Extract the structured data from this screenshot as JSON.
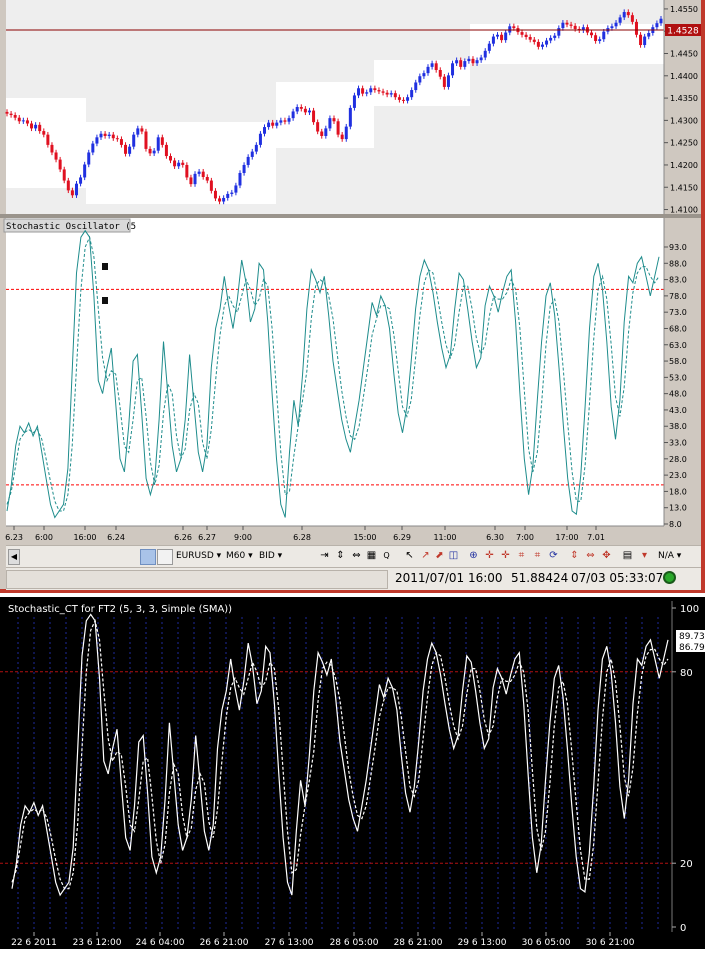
{
  "colors": {
    "price_bg": "#eeeeee",
    "osc_line": "#1e8c8c",
    "level_line": "#ff0000",
    "up_candle": "#2030e0",
    "down_candle": "#e01020",
    "bottom_bg": "#000000",
    "bottom_line": "#ffffff",
    "bottom_level": "#b01010",
    "bottom_grid": "#1e2a9a"
  },
  "price_chart": {
    "price_tag": "1.4528",
    "y_ticks": [
      "1.4550",
      "1.4500",
      "1.4450",
      "1.4400",
      "1.4350",
      "1.4300",
      "1.4250",
      "1.4200",
      "1.4150",
      "1.4100"
    ]
  },
  "oscillator_panel": {
    "title": "Stochastic Oscillator (5",
    "y_ticks": [
      "93.0",
      "88.0",
      "83.0",
      "78.0",
      "73.0",
      "68.0",
      "63.0",
      "58.0",
      "53.0",
      "48.0",
      "43.0",
      "38.0",
      "33.0",
      "28.0",
      "23.0",
      "18.0",
      "13.0",
      "8.0"
    ],
    "x_ticks": [
      "6.23",
      "6:00",
      "16:00",
      "6.24",
      "6.26",
      "6.27",
      "9:00",
      "6.28",
      "15:00",
      "6.29",
      "11:00",
      "6.30",
      "7:00",
      "17:00",
      "7.01"
    ]
  },
  "toolbar": {
    "symbol": "EURUSD",
    "timeframe": "M60",
    "side": "BID",
    "na_label": "N/A"
  },
  "status_bar": {
    "datetime": "2011/07/01 16:00",
    "value": "51.88424",
    "clock": "07/03 05:33:07"
  },
  "bottom_chart": {
    "title": "Stochastic_CT for FT2 (5, 3, 3, Simple (SMA))",
    "y_ticks": [
      "100",
      "80",
      "20",
      "0"
    ],
    "value_tags": [
      "89.73",
      "86.79"
    ],
    "x_ticks": [
      "22 6 2011",
      "23 6 12:00",
      "24 6 04:00",
      "26 6 21:00",
      "27 6 13:00",
      "28 6 05:00",
      "28 6 21:00",
      "29 6 13:00",
      "30 6 05:00",
      "30 6 21:00"
    ]
  },
  "chart_data": [
    {
      "type": "candlestick",
      "title": "",
      "y_range": [
        1.409,
        1.457
      ],
      "close_series": [
        1.4315,
        1.4312,
        1.4306,
        1.4298,
        1.43,
        1.4293,
        1.4282,
        1.429,
        1.4276,
        1.4268,
        1.4245,
        1.4228,
        1.4212,
        1.419,
        1.4165,
        1.4143,
        1.4132,
        1.4158,
        1.4172,
        1.4201,
        1.4228,
        1.4248,
        1.4262,
        1.427,
        1.4265,
        1.4268,
        1.426,
        1.4258,
        1.4245,
        1.4225,
        1.4241,
        1.4268,
        1.4282,
        1.4275,
        1.4236,
        1.4226,
        1.4232,
        1.4262,
        1.4245,
        1.422,
        1.421,
        1.4197,
        1.4205,
        1.42,
        1.4172,
        1.4157,
        1.418,
        1.4185,
        1.4173,
        1.4165,
        1.4142,
        1.4125,
        1.4118,
        1.4126,
        1.4135,
        1.4138,
        1.4154,
        1.4182,
        1.42,
        1.4218,
        1.423,
        1.4245,
        1.427,
        1.4285,
        1.4295,
        1.4288,
        1.4295,
        1.43,
        1.4297,
        1.4305,
        1.432,
        1.433,
        1.4326,
        1.4318,
        1.4322,
        1.4296,
        1.4275,
        1.4265,
        1.4282,
        1.4305,
        1.4298,
        1.4268,
        1.4258,
        1.4286,
        1.4328,
        1.4356,
        1.4372,
        1.436,
        1.4363,
        1.4372,
        1.4368,
        1.4365,
        1.4362,
        1.4358,
        1.4361,
        1.4352,
        1.4346,
        1.4344,
        1.4352,
        1.4368,
        1.4385,
        1.4399,
        1.4406,
        1.442,
        1.4428,
        1.4413,
        1.4398,
        1.4375,
        1.4401,
        1.4428,
        1.4435,
        1.442,
        1.4433,
        1.4438,
        1.4428,
        1.4435,
        1.4441,
        1.4456,
        1.4472,
        1.4488,
        1.4492,
        1.448,
        1.4497,
        1.4511,
        1.4507,
        1.4498,
        1.4492,
        1.4487,
        1.4481,
        1.4476,
        1.4465,
        1.447,
        1.4479,
        1.4485,
        1.449,
        1.4507,
        1.4519,
        1.4515,
        1.4512,
        1.4505,
        1.4502,
        1.4509,
        1.4497,
        1.4491,
        1.4478,
        1.4482,
        1.4499,
        1.4507,
        1.4511,
        1.4519,
        1.4531,
        1.4543,
        1.4536,
        1.4521,
        1.4492,
        1.4469,
        1.4488,
        1.4496,
        1.4509,
        1.4518,
        1.4528
      ]
    },
    {
      "type": "line",
      "title": "Stochastic Oscillator (5",
      "ylim": [
        8,
        93
      ],
      "levels": [
        80,
        20
      ],
      "series": [
        {
          "values": [
            12,
            20,
            32,
            38,
            36,
            39,
            35,
            38,
            30,
            22,
            14,
            10,
            12,
            14,
            25,
            55,
            85,
            96,
            98,
            96,
            78,
            52,
            48,
            56,
            62,
            45,
            28,
            24,
            38,
            58,
            60,
            42,
            22,
            17,
            22,
            40,
            64,
            48,
            32,
            24,
            28,
            40,
            60,
            45,
            30,
            24,
            32,
            56,
            68,
            74,
            84,
            75,
            68,
            77,
            89,
            82,
            70,
            74,
            88,
            86,
            70,
            48,
            28,
            14,
            10,
            30,
            46,
            38,
            54,
            74,
            86,
            83,
            79,
            84,
            72,
            58,
            49,
            40,
            34,
            30,
            38,
            46,
            56,
            66,
            76,
            72,
            78,
            75,
            68,
            54,
            42,
            36,
            44,
            58,
            74,
            84,
            89,
            86,
            79,
            70,
            62,
            56,
            60,
            74,
            85,
            83,
            74,
            64,
            56,
            59,
            75,
            81,
            78,
            73,
            79,
            84,
            86,
            70,
            48,
            28,
            17,
            26,
            46,
            64,
            78,
            82,
            72,
            56,
            38,
            22,
            12,
            11,
            23,
            44,
            68,
            84,
            88,
            80,
            64,
            44,
            34,
            46,
            70,
            84,
            82,
            88,
            90,
            84,
            78,
            84,
            90
          ]
        },
        {
          "values": [
            14,
            18,
            26,
            34,
            36,
            37,
            36,
            37,
            34,
            28,
            21,
            15,
            12,
            12,
            17,
            32,
            56,
            80,
            93,
            96,
            90,
            74,
            59,
            52,
            55,
            54,
            44,
            32,
            30,
            40,
            52,
            53,
            41,
            27,
            20,
            26,
            42,
            51,
            48,
            35,
            28,
            31,
            43,
            48,
            45,
            33,
            28,
            37,
            52,
            66,
            75,
            78,
            75,
            73,
            78,
            83,
            80,
            75,
            77,
            83,
            81,
            68,
            49,
            30,
            17,
            18,
            29,
            38,
            46,
            55,
            71,
            81,
            83,
            82,
            78,
            71,
            60,
            49,
            41,
            35,
            34,
            38,
            47,
            56,
            66,
            71,
            75,
            75,
            74,
            66,
            55,
            44,
            41,
            46,
            59,
            72,
            82,
            86,
            85,
            78,
            70,
            63,
            59,
            63,
            73,
            81,
            81,
            74,
            65,
            60,
            63,
            72,
            78,
            77,
            77,
            79,
            83,
            80,
            68,
            49,
            31,
            24,
            30,
            45,
            63,
            75,
            77,
            70,
            55,
            39,
            24,
            15,
            15,
            26,
            45,
            65,
            80,
            84,
            77,
            63,
            47,
            41,
            50,
            67,
            79,
            85,
            87,
            87,
            84,
            82,
            84
          ]
        }
      ]
    },
    {
      "type": "line",
      "title": "Stochastic_CT for FT2 (5, 3, 3, Simple (SMA))",
      "ylim": [
        0,
        100
      ],
      "levels": [
        80,
        20
      ],
      "series": [
        {
          "values": [
            12,
            20,
            32,
            38,
            36,
            39,
            35,
            38,
            30,
            22,
            14,
            10,
            12,
            14,
            25,
            55,
            85,
            96,
            98,
            96,
            78,
            52,
            48,
            56,
            62,
            45,
            28,
            24,
            38,
            58,
            60,
            42,
            22,
            17,
            22,
            40,
            64,
            48,
            32,
            24,
            28,
            40,
            60,
            45,
            30,
            24,
            32,
            56,
            68,
            74,
            84,
            75,
            68,
            77,
            89,
            82,
            70,
            74,
            88,
            86,
            70,
            48,
            28,
            14,
            10,
            30,
            46,
            38,
            54,
            74,
            86,
            83,
            79,
            84,
            72,
            58,
            49,
            40,
            34,
            30,
            38,
            46,
            56,
            66,
            76,
            72,
            78,
            75,
            68,
            54,
            42,
            36,
            44,
            58,
            74,
            84,
            89,
            86,
            79,
            70,
            62,
            56,
            60,
            74,
            85,
            83,
            74,
            64,
            56,
            59,
            75,
            81,
            78,
            73,
            79,
            84,
            86,
            70,
            48,
            28,
            17,
            26,
            46,
            64,
            78,
            82,
            72,
            56,
            38,
            22,
            12,
            11,
            23,
            44,
            68,
            84,
            88,
            80,
            64,
            44,
            34,
            46,
            70,
            84,
            82,
            88,
            90,
            84,
            78,
            84,
            90
          ]
        },
        {
          "values": [
            14,
            18,
            26,
            34,
            36,
            37,
            36,
            37,
            34,
            28,
            21,
            15,
            12,
            12,
            17,
            32,
            56,
            80,
            93,
            96,
            90,
            74,
            59,
            52,
            55,
            54,
            44,
            32,
            30,
            40,
            52,
            53,
            41,
            27,
            20,
            26,
            42,
            51,
            48,
            35,
            28,
            31,
            43,
            48,
            45,
            33,
            28,
            37,
            52,
            66,
            75,
            78,
            75,
            73,
            78,
            83,
            80,
            75,
            77,
            83,
            81,
            68,
            49,
            30,
            17,
            18,
            29,
            38,
            46,
            55,
            71,
            81,
            83,
            82,
            78,
            71,
            60,
            49,
            41,
            35,
            34,
            38,
            47,
            56,
            66,
            71,
            75,
            75,
            74,
            66,
            55,
            44,
            41,
            46,
            59,
            72,
            82,
            86,
            85,
            78,
            70,
            63,
            59,
            63,
            73,
            81,
            81,
            74,
            65,
            60,
            63,
            72,
            78,
            77,
            77,
            79,
            83,
            80,
            68,
            49,
            31,
            24,
            30,
            45,
            63,
            75,
            77,
            70,
            55,
            39,
            24,
            15,
            15,
            26,
            45,
            65,
            80,
            84,
            77,
            63,
            47,
            41,
            50,
            67,
            79,
            85,
            87,
            87,
            84,
            82,
            84
          ]
        }
      ]
    }
  ]
}
